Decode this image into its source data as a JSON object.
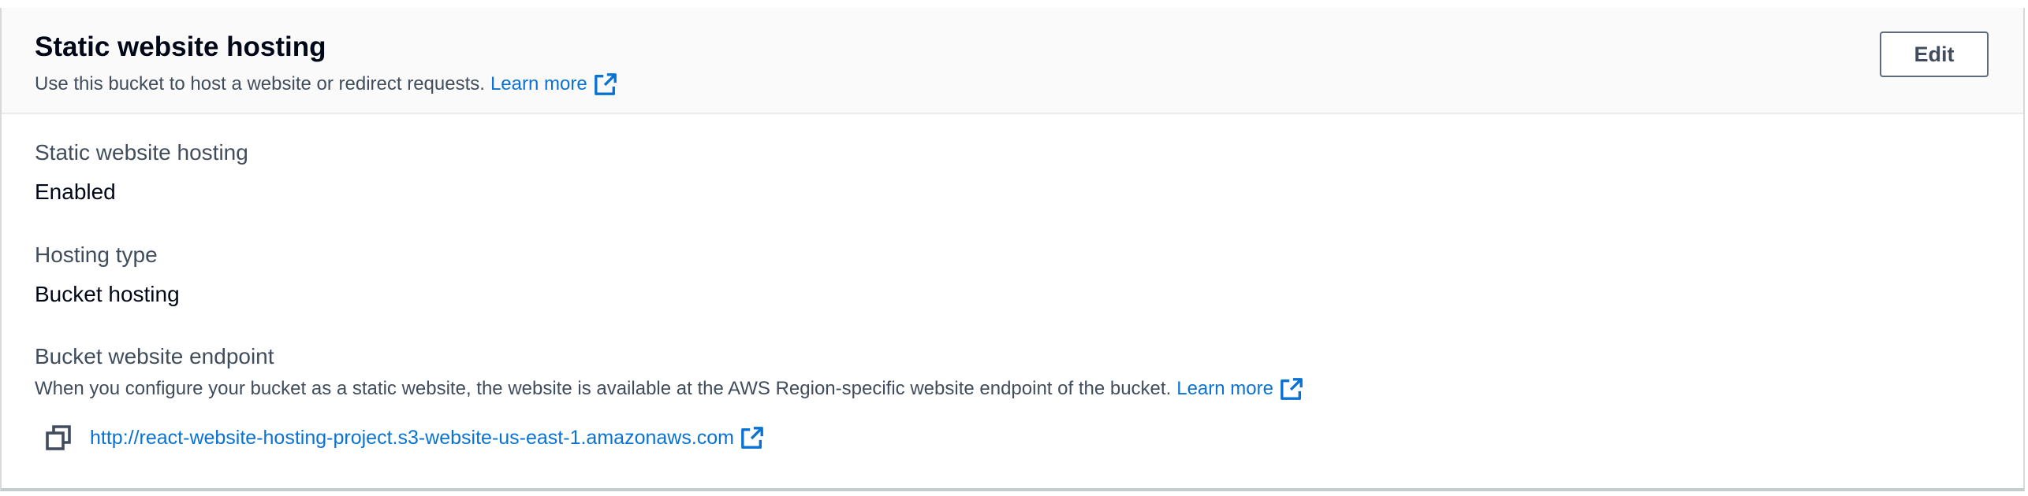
{
  "header": {
    "title": "Static website hosting",
    "description": "Use this bucket to host a website or redirect requests.",
    "learn_more": "Learn more",
    "edit_label": "Edit"
  },
  "fields": {
    "hosting": {
      "label": "Static website hosting",
      "value": "Enabled"
    },
    "hosting_type": {
      "label": "Hosting type",
      "value": "Bucket hosting"
    },
    "endpoint": {
      "label": "Bucket website endpoint",
      "description": "When you configure your bucket as a static website, the website is available at the AWS Region-specific website endpoint of the bucket.",
      "learn_more": "Learn more",
      "url": "http://react-website-hosting-project.s3-website-us-east-1.amazonaws.com"
    }
  },
  "icons": {
    "external_link": "external-link-icon",
    "copy": "copy-icon"
  },
  "colors": {
    "link": "#0972d3",
    "header_bg": "#fafafa",
    "text": "#000716",
    "secondary_text": "#414d5c"
  }
}
